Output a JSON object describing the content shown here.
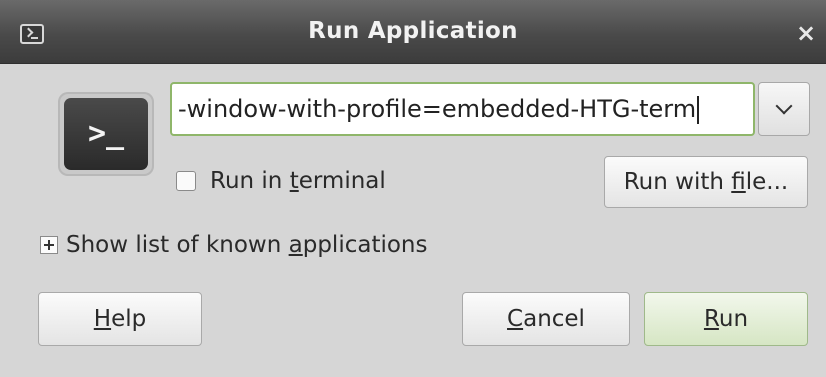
{
  "window": {
    "title": "Run Application",
    "close_glyph": "×",
    "title_icon": "terminal-icon"
  },
  "app_icon": {
    "name": "terminal-icon",
    "glyph": ">_"
  },
  "command": {
    "value": "-window-with-profile=embedded-HTG-term"
  },
  "run_in_terminal": {
    "label_before": "Run in ",
    "mnemonic": "t",
    "label_after": "erminal",
    "checked": false
  },
  "run_with_file": {
    "label_before": "Run with ",
    "mnemonic": "f",
    "label_after": "ile..."
  },
  "expander": {
    "label_before": "Show list of known ",
    "mnemonic": "a",
    "label_after": "pplications",
    "expanded": false
  },
  "buttons": {
    "help": {
      "mnemonic": "H",
      "rest": "elp"
    },
    "cancel": {
      "mnemonic": "C",
      "rest": "ancel"
    },
    "run": {
      "mnemonic": "R",
      "rest": "un"
    }
  },
  "colors": {
    "titlebar": "#4a4a4a",
    "entry_border": "#8fb66a",
    "run_button": "#d6e6c4"
  }
}
